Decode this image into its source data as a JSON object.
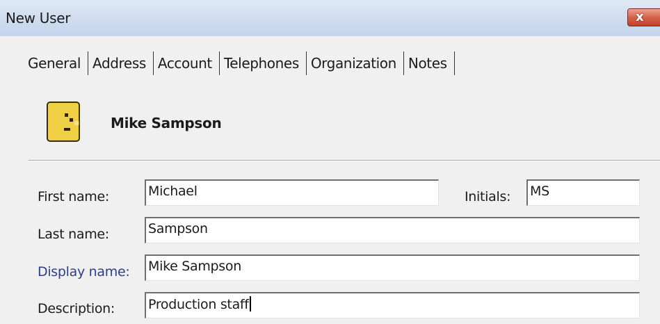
{
  "window": {
    "title": "New User",
    "close_glyph": "x"
  },
  "tabs": [
    {
      "label": "General",
      "active": true
    },
    {
      "label": "Address",
      "active": false
    },
    {
      "label": "Account",
      "active": false
    },
    {
      "label": "Telephones",
      "active": false
    },
    {
      "label": "Organization",
      "active": false
    },
    {
      "label": "Notes",
      "active": false
    }
  ],
  "header": {
    "icon": "user-face-icon",
    "icon_color": "#f0d145",
    "user_name": "Mike Sampson"
  },
  "form": {
    "first_name": {
      "label": "First name:",
      "value": "Michael"
    },
    "initials": {
      "label": "Initials:",
      "value": "MS"
    },
    "last_name": {
      "label": "Last name:",
      "value": "Sampson"
    },
    "display_name": {
      "label": "Display name:",
      "value": "Mike Sampson"
    },
    "description": {
      "label": "Description:",
      "value": "Production staff"
    }
  },
  "colors": {
    "titlebar": "#cfdcee",
    "close_button": "#c2412a",
    "link_label": "#2c3e8c",
    "dialog_background": "#f0f0f0"
  }
}
